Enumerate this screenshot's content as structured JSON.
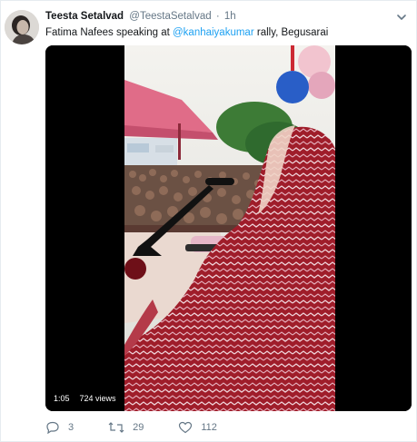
{
  "tweet": {
    "display_name": "Teesta Setalvad",
    "handle": "@TeestaSetalvad",
    "separator": "·",
    "time": "1h",
    "text_before": "Fatima Nafees speaking at ",
    "mention": "@kanhaiyakumar",
    "text_after": " rally, Begusarai"
  },
  "video": {
    "duration": "1:05",
    "views": "724 views"
  },
  "actions": {
    "reply_count": "3",
    "retweet_count": "29",
    "like_count": "112"
  },
  "colors": {
    "accent": "#1da1f2",
    "muted": "#657786",
    "scarf": "#9f1d2a"
  },
  "icons": [
    "avatar",
    "chevron-down-icon",
    "reply-icon",
    "retweet-icon",
    "heart-icon"
  ]
}
